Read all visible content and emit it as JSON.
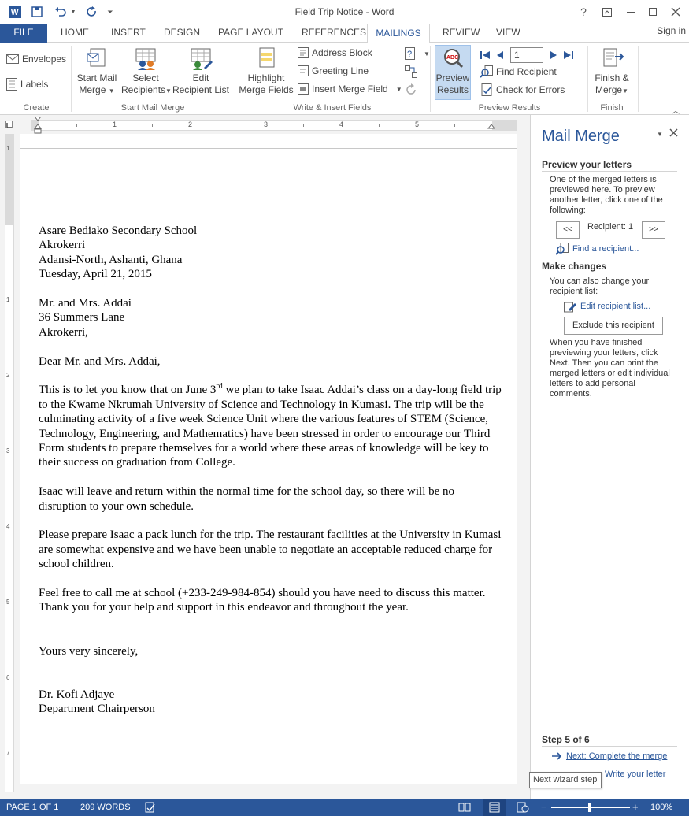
{
  "app": {
    "title": "Field Trip Notice - Word",
    "signin": "Sign in",
    "help": "?",
    "colors": {
      "accent": "#2b579a",
      "pane_selected": "#c5daf1"
    }
  },
  "tabs": [
    {
      "label": "FILE"
    },
    {
      "label": "HOME"
    },
    {
      "label": "INSERT"
    },
    {
      "label": "DESIGN"
    },
    {
      "label": "PAGE LAYOUT"
    },
    {
      "label": "REFERENCES"
    },
    {
      "label": "MAILINGS"
    },
    {
      "label": "REVIEW"
    },
    {
      "label": "VIEW"
    }
  ],
  "ribbon": {
    "create": {
      "label": "Create",
      "envelopes": "Envelopes",
      "labels": "Labels"
    },
    "start": {
      "label": "Start Mail Merge",
      "start_l1": "Start Mail",
      "start_l2": "Merge",
      "select_l1": "Select",
      "select_l2": "Recipients",
      "edit_l1": "Edit",
      "edit_l2": "Recipient List"
    },
    "write": {
      "label": "Write & Insert Fields",
      "highlight_l1": "Highlight",
      "highlight_l2": "Merge Fields",
      "address_block": "Address Block",
      "greeting_line": "Greeting Line",
      "insert_merge_field": "Insert Merge Field"
    },
    "preview": {
      "label": "Preview Results",
      "preview_l1": "Preview",
      "preview_l2": "Results",
      "record": "1",
      "find_recipient": "Find Recipient",
      "check_errors": "Check for Errors"
    },
    "finish": {
      "label": "Finish",
      "finish_l1": "Finish &",
      "finish_l2": "Merge"
    }
  },
  "ruler": {
    "h_numbers": [
      "1",
      "2",
      "3",
      "4",
      "5"
    ],
    "v_numbers": [
      "1",
      "1",
      "2",
      "3",
      "4",
      "5",
      "6",
      "7"
    ]
  },
  "letter": {
    "sender": [
      "Asare Bediako Secondary School",
      "Akrokerri",
      "Adansi-North, Ashanti, Ghana",
      "Tuesday, April 21, 2015"
    ],
    "recipient": [
      "Mr. and Mrs. Addai",
      "36 Summers Lane",
      "Akrokerri,"
    ],
    "greeting": "Dear Mr. and Mrs. Addai,",
    "p1_a": "This is to let you know that on June 3",
    "p1_sup": "rd",
    "p1_b": " we plan to take Isaac Addai’s class on a day-long field trip to the Kwame Nkrumah University of Science and Technology in Kumasi. The trip will be the culminating activity of a five week Science Unit where the various features of STEM (Science, Technology, Engineering, and Mathematics) have been stressed in order to encourage our Third Form students to prepare themselves for a world where these areas of knowledge will be key to their success on graduation from College.",
    "p2": "Isaac will leave and return within the normal time for the school day, so there will be no disruption to your own schedule.",
    "p3": "Please prepare Isaac a pack lunch for the trip. The restaurant facilities at the University in Kumasi are somewhat expensive and we have been unable to negotiate an acceptable reduced charge for school children.",
    "p4": "Feel free to call me at school (+233-249-984-854) should you have need to discuss this matter.  Thank you for your help and support in this endeavor and throughout the year.",
    "closing": "Yours very sincerely,",
    "signature": [
      "Dr. Kofi Adjaye",
      "Department Chairperson"
    ]
  },
  "pane": {
    "title": "Mail Merge",
    "preview_heading": "Preview your letters",
    "preview_text": "One of the merged letters is previewed here. To preview another letter, click one of the following:",
    "prev_btn": "<<",
    "next_btn": ">>",
    "recipient_label": "Recipient: 1",
    "find_link": "Find a recipient...",
    "changes_heading": "Make changes",
    "changes_text": "You can also change your recipient list:",
    "edit_link": "Edit recipient list...",
    "exclude_btn": "Exclude this recipient",
    "finish_text": "When you have finished previewing your letters, click Next. Then you can print the merged letters or edit individual letters to add personal comments.",
    "step": "Step 5 of 6",
    "next_link": "Next: Complete the merge",
    "prev_link": "Write your letter",
    "tooltip": "Next wizard step"
  },
  "status": {
    "page": "PAGE 1 OF 1",
    "words": "209 WORDS",
    "zoom": "100%"
  }
}
